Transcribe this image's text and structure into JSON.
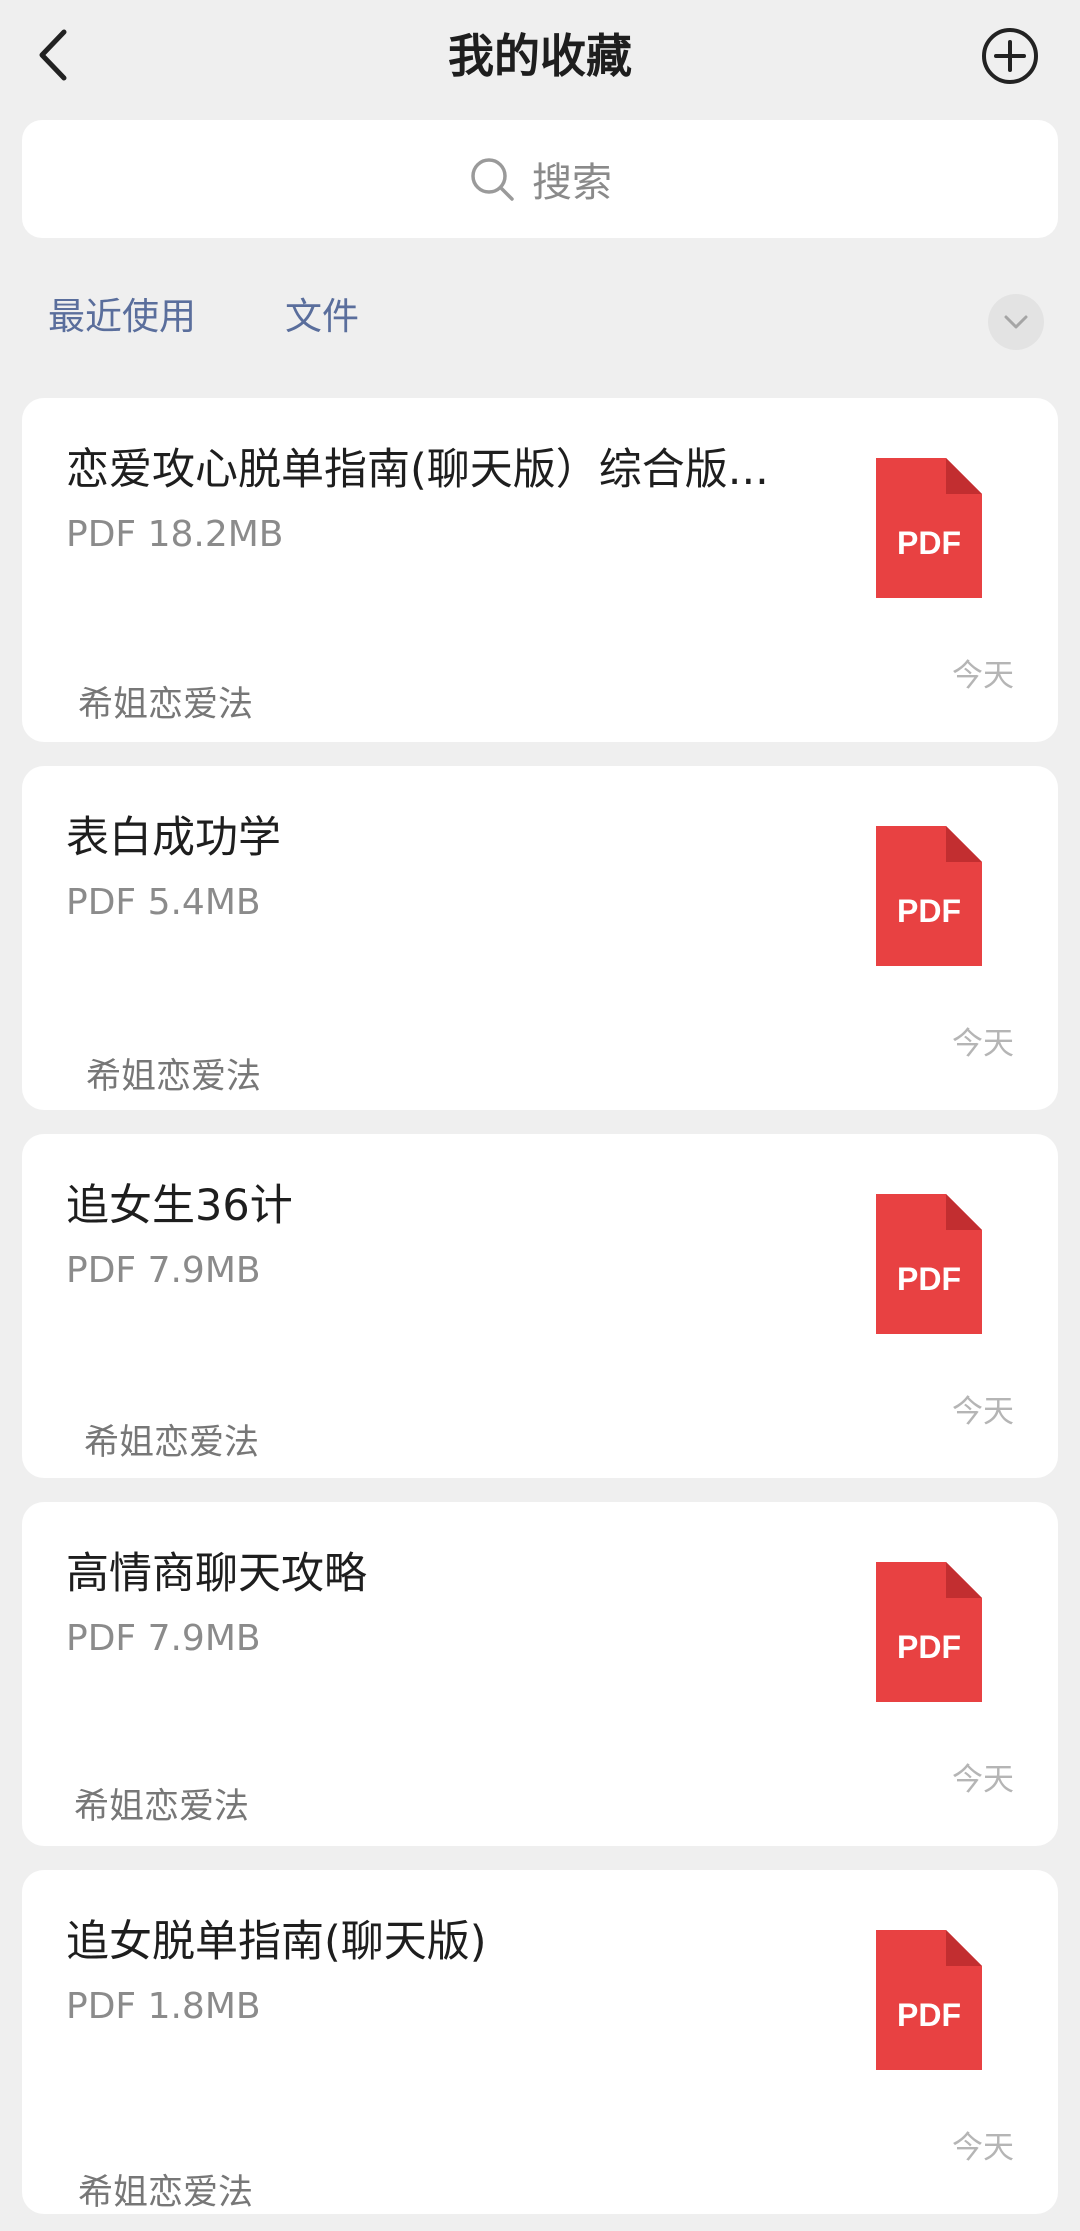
{
  "header": {
    "title": "我的收藏"
  },
  "search": {
    "placeholder": "搜索"
  },
  "filters": [
    {
      "label": "最近使用"
    },
    {
      "label": "文件"
    }
  ],
  "colors": {
    "accent_tab": "#5a6e9c",
    "pdf_red": "#e84142",
    "pdf_fold": "#c22e30"
  },
  "icons": {
    "back": "chevron-left-icon",
    "add": "plus-circle-icon",
    "search": "search-icon",
    "expand": "chevron-down-icon",
    "file": "pdf-file-icon"
  },
  "items": [
    {
      "name": "恋爱攻心脱单指南(聊天版）综合版...",
      "meta": "PDF 18.2MB",
      "icon_text": "PDF",
      "date": "今天",
      "watermark": "希姐恋爱法"
    },
    {
      "name": "表白成功学",
      "meta": "PDF 5.4MB",
      "icon_text": "PDF",
      "date": "今天",
      "watermark": "希姐恋爱法"
    },
    {
      "name": "追女生36计",
      "meta": "PDF 7.9MB",
      "icon_text": "PDF",
      "date": "今天",
      "watermark": "希姐恋爱法"
    },
    {
      "name": "高情商聊天攻略",
      "meta": "PDF 7.9MB",
      "icon_text": "PDF",
      "date": "今天",
      "watermark": "希姐恋爱法"
    },
    {
      "name": "追女脱单指南(聊天版)",
      "meta": "PDF 1.8MB",
      "icon_text": "PDF",
      "date": "今天",
      "watermark": "希姐恋爱法"
    }
  ]
}
